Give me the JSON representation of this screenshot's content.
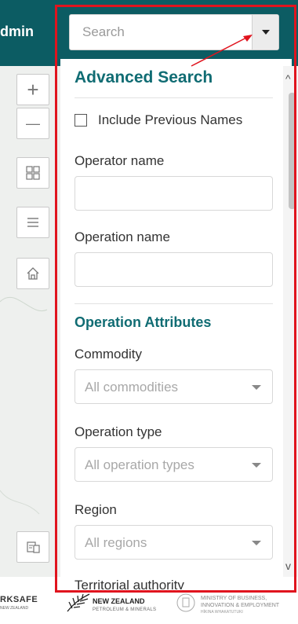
{
  "header": {
    "admin_text": "dmin",
    "search": {
      "placeholder": "Search",
      "dropdown_icon": "caret-down-icon"
    }
  },
  "map_controls": {
    "zoom_in": "+",
    "zoom_out": "—",
    "icons": [
      "basemap-grid-icon",
      "layer-list-icon",
      "home-icon",
      "print-icon"
    ]
  },
  "advanced_search": {
    "title": "Advanced Search",
    "include_previous_names": {
      "label": "Include Previous Names",
      "checked": false
    },
    "operator_name": {
      "label": "Operator name",
      "value": ""
    },
    "operation_name": {
      "label": "Operation name",
      "value": ""
    },
    "attributes_title": "Operation Attributes",
    "commodity": {
      "label": "Commodity",
      "value": "All commodities"
    },
    "operation_type": {
      "label": "Operation type",
      "value": "All operation types"
    },
    "region": {
      "label": "Region",
      "value": "All regions"
    },
    "territorial_authority": {
      "label": "Territorial authority"
    }
  },
  "footer": {
    "logo1": "RKSAFE",
    "logo1_sub": "NEW ZEALAND",
    "logo2": "NEW ZEALAND",
    "logo2_sub": "PETROLEUM & MINERALS",
    "logo3": "MINISTRY OF BUSINESS, INNOVATION & EMPLOYMENT",
    "logo3_sub": "HĪKINA WHAKATUTUKI"
  },
  "colors": {
    "header_bg": "#0c5c63",
    "heading_teal": "#106c73",
    "highlight_red": "#e0141e"
  }
}
